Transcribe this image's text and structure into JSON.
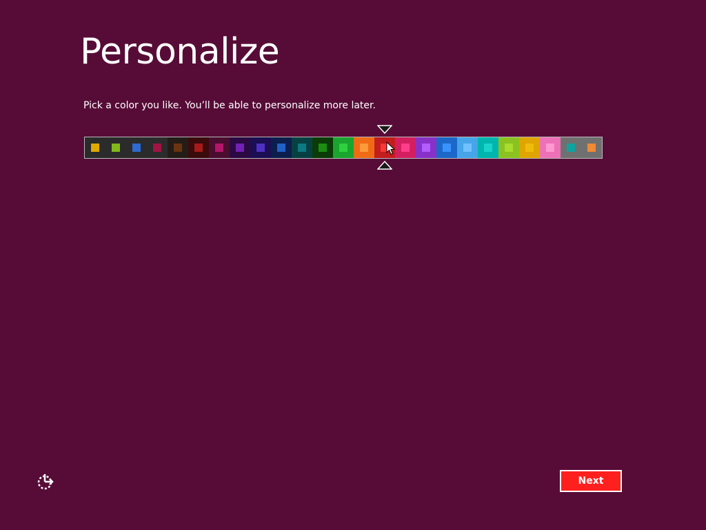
{
  "page": {
    "title": "Personalize",
    "subtitle": "Pick a color you like. You’ll be able to personalize more later.",
    "background_color": "#570c37",
    "accent_color": "#fe1f1f"
  },
  "palette": {
    "selected_index": 14,
    "swatches": [
      {
        "bg": "#2b2b2b",
        "chip": "#e0a900"
      },
      {
        "bg": "#2b2b2b",
        "chip": "#82b81d"
      },
      {
        "bg": "#2b2b2b",
        "chip": "#2d6bd2"
      },
      {
        "bg": "#2b2b2b",
        "chip": "#a11343"
      },
      {
        "bg": "#241c17",
        "chip": "#6b3410"
      },
      {
        "bg": "#3b0b0b",
        "chip": "#a71a1a"
      },
      {
        "bg": "#4a0d2f",
        "chip": "#b3166a"
      },
      {
        "bg": "#2b0a43",
        "chip": "#7320b6"
      },
      {
        "bg": "#1b0e53",
        "chip": "#4e31c2"
      },
      {
        "bg": "#0c1e4d",
        "chip": "#2161c6"
      },
      {
        "bg": "#074043",
        "chip": "#0c7a83"
      },
      {
        "bg": "#0b3b06",
        "chip": "#1a8f14"
      },
      {
        "bg": "#1aa52f",
        "chip": "#2fd13e"
      },
      {
        "bg": "#ef6b16",
        "chip": "#ff9a3c"
      },
      {
        "bg": "#c31d1d",
        "chip": "#fe3636"
      },
      {
        "bg": "#d31f5f",
        "chip": "#ff3e8a"
      },
      {
        "bg": "#8731c9",
        "chip": "#b35cff"
      },
      {
        "bg": "#1c68c9",
        "chip": "#3a92ff"
      },
      {
        "bg": "#46a4e8",
        "chip": "#6fc2ff"
      },
      {
        "bg": "#00b5ae",
        "chip": "#19d4cb"
      },
      {
        "bg": "#8bc221",
        "chip": "#a8dc2e"
      },
      {
        "bg": "#e0a500",
        "chip": "#f0bc0b"
      },
      {
        "bg": "#ed71b7",
        "chip": "#ff98d2"
      },
      {
        "bg": "#707070",
        "chip": "#0fa3a0"
      },
      {
        "bg": "#707070",
        "chip": "#f08a33"
      }
    ]
  },
  "footer": {
    "ease_of_access_icon": "ease-of-access-icon",
    "next_label": "Next"
  }
}
